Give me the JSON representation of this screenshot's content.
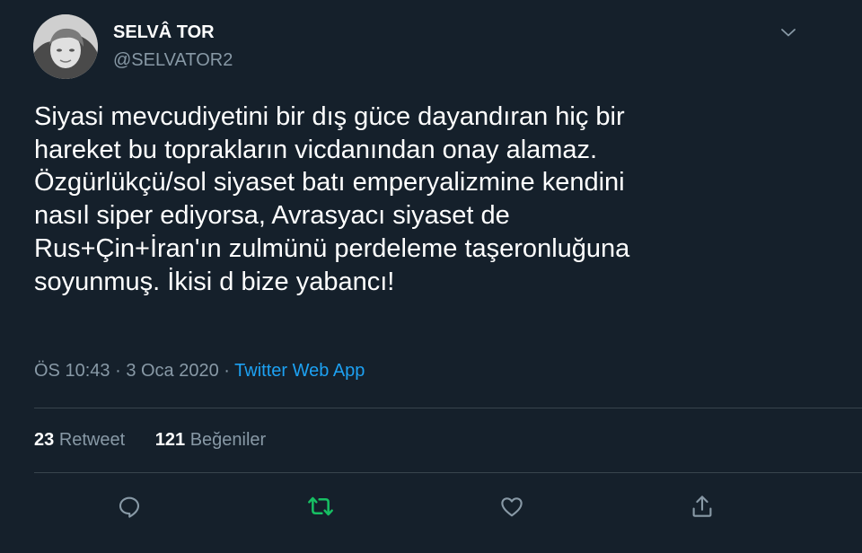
{
  "author": {
    "name": "SELVÂ TOR",
    "handle": "@SELVATOR2"
  },
  "tweet": {
    "lines": [
      "Siyasi mevcudiyetini bir dış güce dayandıran hiç bir",
      "hareket bu toprakların vicdanından onay alamaz.",
      "Özgürlükçü/sol siyaset batı emperyalizmine kendini",
      "nasıl siper ediyorsa, Avrasyacı siyaset de",
      "Rus+Çin+İran'ın zulmünü perdeleme taşeronluğuna",
      "soyunmuş. İkisi d bize yabancı!"
    ],
    "time": "ÖS 10:43",
    "date": "3 Oca 2020",
    "separator": "·",
    "source": "Twitter Web App"
  },
  "stats": {
    "retweets_count": "23",
    "retweets_label": "Retweet",
    "likes_count": "121",
    "likes_label": "Beğeniler"
  },
  "actions": [
    {
      "icon": "reply-icon"
    },
    {
      "icon": "retweet-icon",
      "color": "#17bf63"
    },
    {
      "icon": "like-icon"
    },
    {
      "icon": "share-icon"
    }
  ],
  "colors": {
    "background": "#15202b",
    "secondary_text": "#8899a6",
    "link": "#1da1f2",
    "retweet_active": "#17bf63",
    "divider": "#38444d"
  }
}
